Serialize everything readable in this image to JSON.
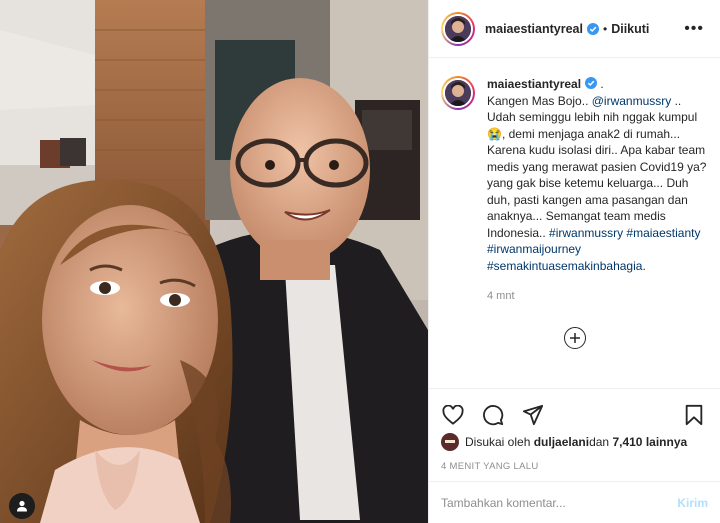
{
  "colors": {
    "text": "#262626",
    "link": "#00376b",
    "muted": "#8e8e8e",
    "verified": "#3897f0",
    "send_disabled": "#b2dffc",
    "divider": "#efefef"
  },
  "photo": {
    "description_icon": "user-tag-icon"
  },
  "header": {
    "username": "maiaestiantyreal",
    "separator": "•",
    "follow_state": "Diikuti",
    "more_icon": "more-horizontal-icon"
  },
  "caption": {
    "username": "maiaestiantyreal",
    "trailing": " .",
    "line1": "Kangen Mas Bojo.. ",
    "mention": "@irwanmussry",
    "line2": " .. Udah seminggu lebih nih nggak kumpul ",
    "emoji": "😭",
    "line3": ", demi menjaga anak2 di rumah... Karena kudu isolasi diri.. Apa kabar team medis yang merawat pasien Covid19 ya? yang gak bise ketemu keluarga... Duh duh, pasti kangen ama pasangan dan anaknya... Semangat team medis Indonesia.. ",
    "tag1": "#irwanmussry",
    "tag2": "#maiaestianty",
    "tag3": "#irwanmaijourney",
    "tag4": "#semakintuasemakinbahagia",
    "tag_end": ".",
    "time": "4 mnt"
  },
  "actions": {
    "like_icon": "heart-icon",
    "comment_icon": "comment-icon",
    "share_icon": "send-icon",
    "save_icon": "bookmark-icon"
  },
  "likes": {
    "prefix": "Disukai oleh ",
    "first_user": "duljaelani",
    "middle": " dan ",
    "count": "7,410 lainnya"
  },
  "posted_ago": "4 MENIT YANG LALU",
  "comment_box": {
    "placeholder": "Tambahkan komentar...",
    "send_label": "Kirim"
  }
}
